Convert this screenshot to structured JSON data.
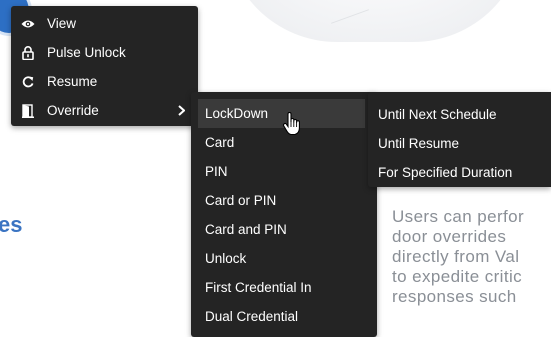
{
  "background": {
    "heading_fragment": "es",
    "description_lines": [
      "Users can perfor",
      "door overrides",
      "directly from Val",
      "to expedite critic",
      "responses such"
    ]
  },
  "context_menu": {
    "items": [
      {
        "label": "View",
        "icon": "eye-icon"
      },
      {
        "label": "Pulse Unlock",
        "icon": "padlock-open-icon"
      },
      {
        "label": "Resume",
        "icon": "refresh-icon"
      },
      {
        "label": "Override",
        "icon": "door-icon",
        "has_submenu": true
      }
    ]
  },
  "override_submenu": {
    "items": [
      {
        "label": "LockDown",
        "hovered": true
      },
      {
        "label": "Card"
      },
      {
        "label": "PIN"
      },
      {
        "label": "Card or PIN"
      },
      {
        "label": "Card and PIN"
      },
      {
        "label": "Unlock"
      },
      {
        "label": "First Credential In"
      },
      {
        "label": "Dual Credential"
      }
    ]
  },
  "duration_submenu": {
    "items": [
      {
        "label": "Until Next Schedule"
      },
      {
        "label": "Until Resume"
      },
      {
        "label": "For Specified Duration"
      }
    ]
  },
  "colors": {
    "menu_bg": "#242424",
    "menu_hover": "#3a3a3a",
    "menu_text": "#ffffff",
    "heading_blue": "#3b74c2",
    "description_gray": "#8a8f96"
  }
}
